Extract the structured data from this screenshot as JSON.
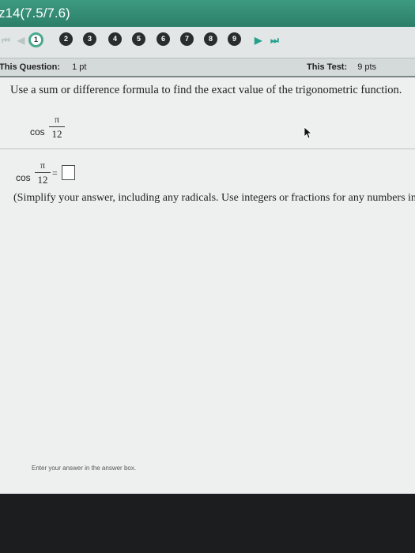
{
  "window": {
    "title": "z14(7.5/7.6)"
  },
  "nav": {
    "first_arrow": "⏮",
    "prev_arrow": "◀",
    "next_arrow": "▶",
    "last_arrow": "⏭",
    "questions": [
      "1",
      "2",
      "3",
      "4",
      "5",
      "6",
      "7",
      "8",
      "9"
    ],
    "current": "1"
  },
  "info": {
    "question_label": "This Question:",
    "question_points": "1 pt",
    "test_label": "This Test:",
    "test_points": "9 pts"
  },
  "problem": {
    "prompt": "Use a sum or difference formula to find the exact value of the trigonometric function.",
    "func": "cos",
    "numerator": "π",
    "denominator": "12",
    "equals": "=",
    "hint": "(Simplify your answer, including any radicals. Use integers or fractions for any numbers in the expression.)"
  },
  "status_text": "Enter your answer in the answer box."
}
